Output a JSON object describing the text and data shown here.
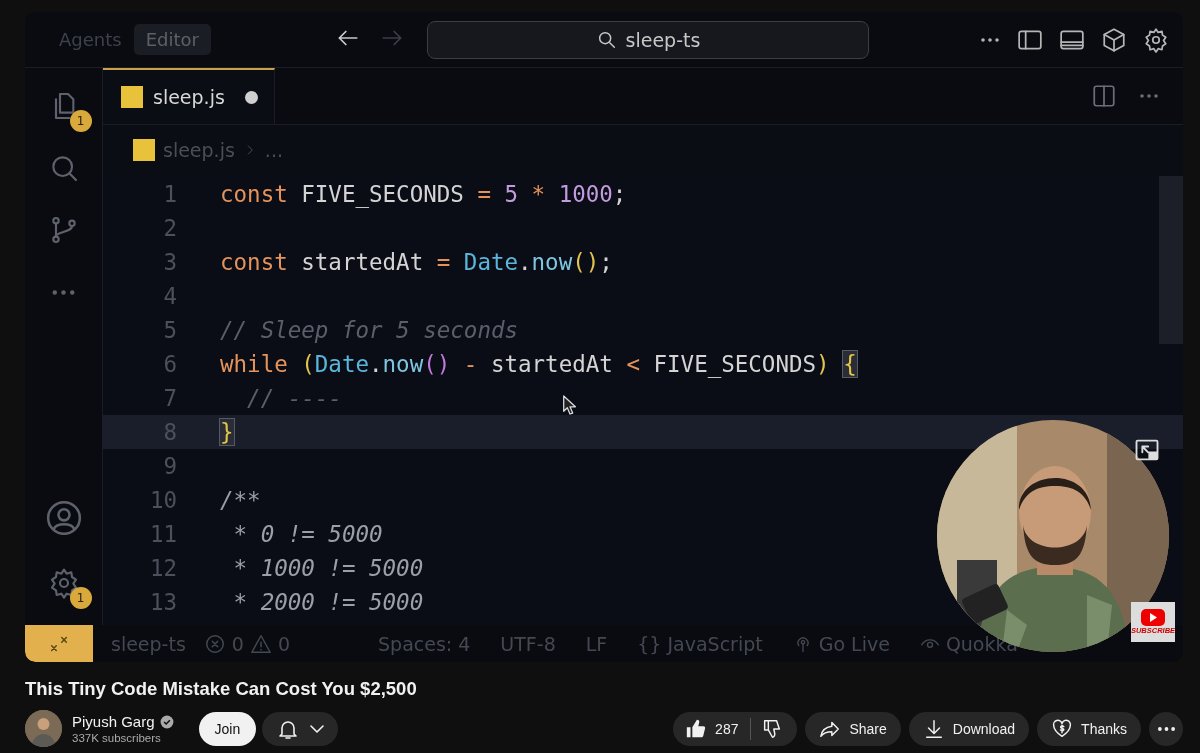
{
  "video": {
    "editor_topbar": {
      "modes": [
        {
          "label": "Agents",
          "selected": false
        },
        {
          "label": "Editor",
          "selected": true
        }
      ],
      "search": {
        "value": "sleep-ts"
      }
    },
    "activity_bar": {
      "files_badge": "1",
      "settings_badge": "1"
    },
    "tabs": [
      {
        "label": "sleep.js",
        "modified": true,
        "selected": true
      }
    ],
    "breadcrumb": [
      "sleep.js",
      "..."
    ],
    "code_lines": [
      {
        "number": "1",
        "current": false,
        "tokens": [
          {
            "text": "const ",
            "kind": "kw"
          },
          {
            "text": "FIVE_SECONDS ",
            "kind": "id"
          },
          {
            "text": "= ",
            "kind": "op"
          },
          {
            "text": "5 ",
            "kind": "num"
          },
          {
            "text": "* ",
            "kind": "op"
          },
          {
            "text": "1000",
            "kind": "num"
          },
          {
            "text": ";",
            "kind": "id"
          }
        ]
      },
      {
        "number": "2",
        "current": false
      },
      {
        "number": "3",
        "current": false,
        "tokens": [
          {
            "text": "const ",
            "kind": "kw"
          },
          {
            "text": "startedAt ",
            "kind": "id"
          },
          {
            "text": "= ",
            "kind": "op"
          },
          {
            "text": "Date",
            "kind": "cls"
          },
          {
            "text": ".",
            "kind": "id"
          },
          {
            "text": "now",
            "kind": "fn"
          },
          {
            "text": "()",
            "kind": "paren"
          },
          {
            "text": ";",
            "kind": "id"
          }
        ]
      },
      {
        "number": "4",
        "current": false
      },
      {
        "number": "5",
        "current": false,
        "tokens": [
          {
            "text": "// Sleep for 5 seconds",
            "kind": "cmt"
          }
        ]
      },
      {
        "number": "6",
        "current": false,
        "tokens": [
          {
            "text": "while ",
            "kind": "kw"
          },
          {
            "text": "(",
            "kind": "paren"
          },
          {
            "text": "Date",
            "kind": "cls"
          },
          {
            "text": ".",
            "kind": "id"
          },
          {
            "text": "now",
            "kind": "fn"
          },
          {
            "text": "()",
            "kind": "paren2"
          },
          {
            "text": " - ",
            "kind": "op"
          },
          {
            "text": "startedAt ",
            "kind": "id"
          },
          {
            "text": "< ",
            "kind": "op"
          },
          {
            "text": "FIVE_SECONDS",
            "kind": "id"
          },
          {
            "text": ") ",
            "kind": "paren"
          },
          {
            "text": "{",
            "kind": "match"
          }
        ]
      },
      {
        "number": "7",
        "current": false,
        "tokens": [
          {
            "text": "  // ----",
            "kind": "cmt"
          }
        ]
      },
      {
        "number": "8",
        "current": true,
        "tokens": [
          {
            "text": "}",
            "kind": "match"
          }
        ]
      },
      {
        "number": "9",
        "current": false
      },
      {
        "number": "10",
        "current": false,
        "tokens": [
          {
            "text": "/**",
            "kind": "doc"
          }
        ]
      },
      {
        "number": "11",
        "current": false,
        "tokens": [
          {
            "text": " * 0 != 5000",
            "kind": "doc"
          }
        ]
      },
      {
        "number": "12",
        "current": false,
        "tokens": [
          {
            "text": " * 1000 != 5000",
            "kind": "doc"
          }
        ]
      },
      {
        "number": "13",
        "current": false,
        "tokens": [
          {
            "text": " * 2000 != 5000",
            "kind": "doc"
          }
        ]
      }
    ],
    "status_bar": {
      "branch": "sleep-ts",
      "errors": "0",
      "warnings": "0",
      "items": [
        {
          "kind": "text",
          "label": "Spaces: 4"
        },
        {
          "kind": "text",
          "label": "UTF-8"
        },
        {
          "kind": "text",
          "label": "LF"
        },
        {
          "kind": "language",
          "glyph": "{}",
          "label": "JavaScript"
        },
        {
          "kind": "live",
          "label": "Go Live"
        },
        {
          "kind": "eye",
          "label": "Quokka"
        }
      ]
    },
    "webcam": {
      "kind": "picture"
    },
    "subscribe_badge": "SUBSCRIBE"
  },
  "title": "This Tiny Code Mistake Can Cost You $2,500",
  "channel": {
    "name": "Piyush Garg",
    "verified": true,
    "subscribers": "337K subscribers"
  },
  "join": "Join",
  "likes": "287",
  "actions": [
    {
      "kind": "share",
      "label": "Share"
    },
    {
      "kind": "download",
      "label": "Download"
    },
    {
      "kind": "thanks",
      "label": "Thanks"
    }
  ]
}
